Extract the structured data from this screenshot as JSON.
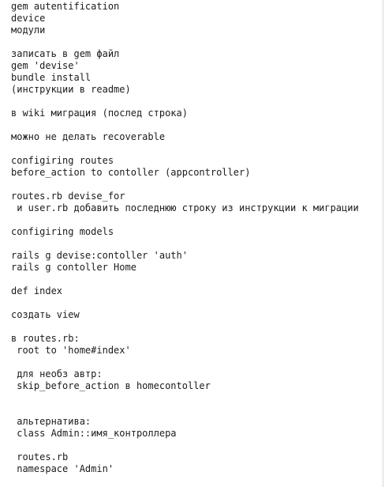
{
  "document": {
    "lines": [
      "gem autentification",
      "device",
      "модули",
      "",
      "записать в gem файл",
      "gem 'devise'",
      "bundle install",
      "(инструкции в readme)",
      "",
      "в wiki миграция (послед строка)",
      "",
      "можно не делать recoverable",
      "",
      "configiring routes",
      "before_action to contoller (appcontroller)",
      "",
      "routes.rb devise_for",
      " и user.rb добавить последнюю строку из инструкции к миграции",
      "",
      "configiring models",
      "",
      "rails g devise:contoller 'auth'",
      "rails g contoller Home",
      "",
      "def index",
      "",
      "создать view",
      "",
      "в routes.rb:",
      " root to 'home#index'",
      "",
      " для необз автр:",
      " skip_before_action в homecontoller",
      "",
      "",
      " альтернатива:",
      " class Admin::имя_контроллера",
      "",
      " routes.rb",
      " namespace 'Admin'"
    ]
  }
}
